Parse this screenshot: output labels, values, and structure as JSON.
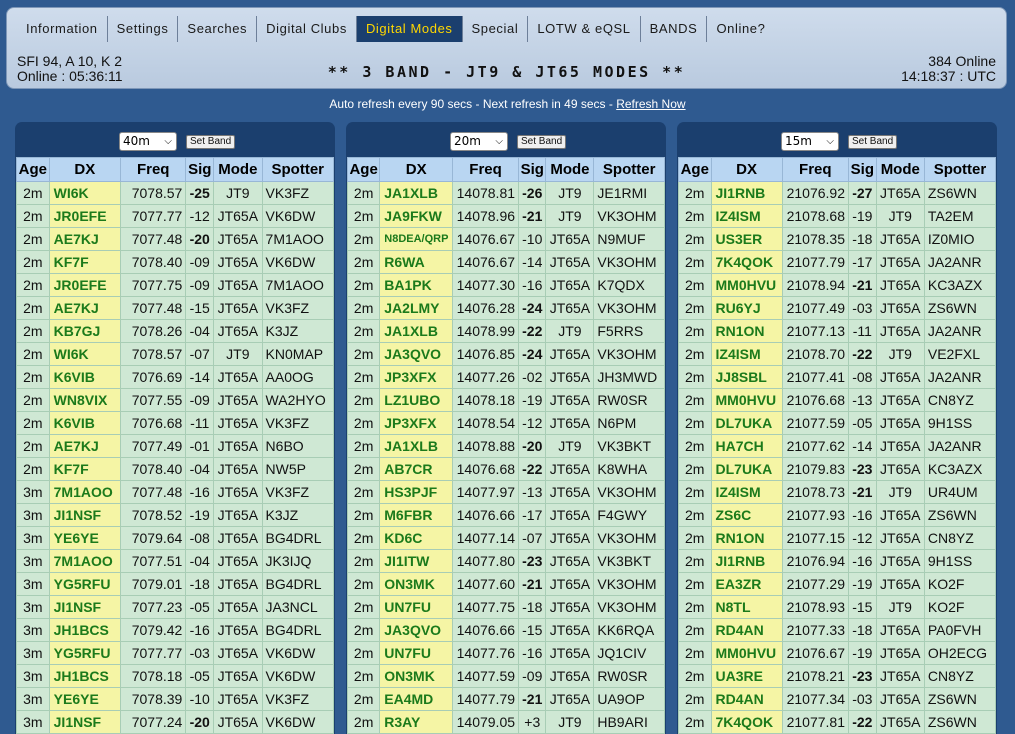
{
  "nav": [
    {
      "label": "Information",
      "active": false
    },
    {
      "label": "Settings",
      "active": false
    },
    {
      "label": "Searches",
      "active": false
    },
    {
      "label": "Digital Clubs",
      "active": false
    },
    {
      "label": "Digital Modes",
      "active": true
    },
    {
      "label": "Special",
      "active": false
    },
    {
      "label": "LOTW & eQSL",
      "active": false
    },
    {
      "label": "BANDS",
      "active": false
    },
    {
      "label": "Online?",
      "active": false
    }
  ],
  "status": {
    "solar": "SFI 94, A 10, K 2",
    "online_time": "Online : 05:36:11",
    "online_count": "384 Online",
    "utc_time": "14:18:37 : UTC"
  },
  "title": "** 3 BAND - JT9 & JT65 MODES **",
  "refresh": {
    "text": "Auto refresh every 90 secs - Next refresh in 49 secs - ",
    "link": "Refresh Now"
  },
  "set_band_label": "Set Band",
  "columns": [
    "Age",
    "DX",
    "Freq",
    "Sig",
    "Mode",
    "Spotter"
  ],
  "panels": [
    {
      "band": "40m",
      "rows": [
        [
          "2m",
          "WI6K",
          "7078.57",
          "-25",
          "JT9",
          "VK3FZ"
        ],
        [
          "2m",
          "JR0EFE",
          "7077.77",
          "-12",
          "JT65A",
          "VK6DW"
        ],
        [
          "2m",
          "AE7KJ",
          "7077.48",
          "-20",
          "JT65A",
          "7M1AOO"
        ],
        [
          "2m",
          "KF7F",
          "7078.40",
          "-09",
          "JT65A",
          "VK6DW"
        ],
        [
          "2m",
          "JR0EFE",
          "7077.75",
          "-09",
          "JT65A",
          "7M1AOO"
        ],
        [
          "2m",
          "AE7KJ",
          "7077.48",
          "-15",
          "JT65A",
          "VK3FZ"
        ],
        [
          "2m",
          "KB7GJ",
          "7078.26",
          "-04",
          "JT65A",
          "K3JZ"
        ],
        [
          "2m",
          "WI6K",
          "7078.57",
          "-07",
          "JT9",
          "KN0MAP"
        ],
        [
          "2m",
          "K6VIB",
          "7076.69",
          "-14",
          "JT65A",
          "AA0OG"
        ],
        [
          "2m",
          "WN8VIX",
          "7077.55",
          "-09",
          "JT65A",
          "WA2HYO"
        ],
        [
          "2m",
          "K6VIB",
          "7076.68",
          "-11",
          "JT65A",
          "VK3FZ"
        ],
        [
          "2m",
          "AE7KJ",
          "7077.49",
          "-01",
          "JT65A",
          "N6BO"
        ],
        [
          "2m",
          "KF7F",
          "7078.40",
          "-04",
          "JT65A",
          "NW5P"
        ],
        [
          "3m",
          "7M1AOO",
          "7077.48",
          "-16",
          "JT65A",
          "VK3FZ"
        ],
        [
          "3m",
          "JI1NSF",
          "7078.52",
          "-19",
          "JT65A",
          "K3JZ"
        ],
        [
          "3m",
          "YE6YE",
          "7079.64",
          "-08",
          "JT65A",
          "BG4DRL"
        ],
        [
          "3m",
          "7M1AOO",
          "7077.51",
          "-04",
          "JT65A",
          "JK3IJQ"
        ],
        [
          "3m",
          "YG5RFU",
          "7079.01",
          "-18",
          "JT65A",
          "BG4DRL"
        ],
        [
          "3m",
          "JI1NSF",
          "7077.23",
          "-05",
          "JT65A",
          "JA3NCL"
        ],
        [
          "3m",
          "JH1BCS",
          "7079.42",
          "-16",
          "JT65A",
          "BG4DRL"
        ],
        [
          "3m",
          "YG5RFU",
          "7077.77",
          "-03",
          "JT65A",
          "VK6DW"
        ],
        [
          "3m",
          "JH1BCS",
          "7078.18",
          "-05",
          "JT65A",
          "VK6DW"
        ],
        [
          "3m",
          "YE6YE",
          "7078.39",
          "-10",
          "JT65A",
          "VK3FZ"
        ],
        [
          "3m",
          "JI1NSF",
          "7077.24",
          "-20",
          "JT65A",
          "VK6DW"
        ]
      ]
    },
    {
      "band": "20m",
      "rows": [
        [
          "2m",
          "JA1XLB",
          "14078.81",
          "-26",
          "JT9",
          "JE1RMI"
        ],
        [
          "2m",
          "JA9FKW",
          "14078.96",
          "-21",
          "JT9",
          "VK3OHM"
        ],
        [
          "2m",
          "N8DEA/QRP",
          "14076.67",
          "-10",
          "JT65A",
          "N9MUF"
        ],
        [
          "2m",
          "R6WA",
          "14076.67",
          "-14",
          "JT65A",
          "VK3OHM"
        ],
        [
          "2m",
          "BA1PK",
          "14077.30",
          "-16",
          "JT65A",
          "K7QDX"
        ],
        [
          "2m",
          "JA2LMY",
          "14076.28",
          "-24",
          "JT65A",
          "VK3OHM"
        ],
        [
          "2m",
          "JA1XLB",
          "14078.99",
          "-22",
          "JT9",
          "F5RRS"
        ],
        [
          "2m",
          "JA3QVO",
          "14076.85",
          "-24",
          "JT65A",
          "VK3OHM"
        ],
        [
          "2m",
          "JP3XFX",
          "14077.26",
          "-02",
          "JT65A",
          "JH3MWD"
        ],
        [
          "2m",
          "LZ1UBO",
          "14078.18",
          "-19",
          "JT65A",
          "RW0SR"
        ],
        [
          "2m",
          "JP3XFX",
          "14078.54",
          "-12",
          "JT65A",
          "N6PM"
        ],
        [
          "2m",
          "JA1XLB",
          "14078.88",
          "-20",
          "JT9",
          "VK3BKT"
        ],
        [
          "2m",
          "AB7CR",
          "14076.68",
          "-22",
          "JT65A",
          "K8WHA"
        ],
        [
          "2m",
          "HS3PJF",
          "14077.97",
          "-13",
          "JT65A",
          "VK3OHM"
        ],
        [
          "2m",
          "M6FBR",
          "14076.66",
          "-17",
          "JT65A",
          "F4GWY"
        ],
        [
          "2m",
          "KD6C",
          "14077.14",
          "-07",
          "JT65A",
          "VK3OHM"
        ],
        [
          "2m",
          "JI1ITW",
          "14077.80",
          "-23",
          "JT65A",
          "VK3BKT"
        ],
        [
          "2m",
          "ON3MK",
          "14077.60",
          "-21",
          "JT65A",
          "VK3OHM"
        ],
        [
          "2m",
          "UN7FU",
          "14077.75",
          "-18",
          "JT65A",
          "VK3OHM"
        ],
        [
          "2m",
          "JA3QVO",
          "14076.66",
          "-15",
          "JT65A",
          "KK6RQA"
        ],
        [
          "2m",
          "UN7FU",
          "14077.76",
          "-16",
          "JT65A",
          "JQ1CIV"
        ],
        [
          "2m",
          "ON3MK",
          "14077.59",
          "-09",
          "JT65A",
          "RW0SR"
        ],
        [
          "2m",
          "EA4MD",
          "14077.79",
          "-21",
          "JT65A",
          "UA9OP"
        ],
        [
          "2m",
          "R3AY",
          "14079.05",
          "+3",
          "JT9",
          "HB9ARI"
        ]
      ]
    },
    {
      "band": "15m",
      "rows": [
        [
          "2m",
          "JI1RNB",
          "21076.92",
          "-27",
          "JT65A",
          "ZS6WN"
        ],
        [
          "2m",
          "IZ4ISM",
          "21078.68",
          "-19",
          "JT9",
          "TA2EM"
        ],
        [
          "2m",
          "US3ER",
          "21078.35",
          "-18",
          "JT65A",
          "IZ0MIO"
        ],
        [
          "2m",
          "7K4QOK",
          "21077.79",
          "-17",
          "JT65A",
          "JA2ANR"
        ],
        [
          "2m",
          "MM0HVU",
          "21078.94",
          "-21",
          "JT65A",
          "KC3AZX"
        ],
        [
          "2m",
          "RU6YJ",
          "21077.49",
          "-03",
          "JT65A",
          "ZS6WN"
        ],
        [
          "2m",
          "RN1ON",
          "21077.13",
          "-11",
          "JT65A",
          "JA2ANR"
        ],
        [
          "2m",
          "IZ4ISM",
          "21078.70",
          "-22",
          "JT9",
          "VE2FXL"
        ],
        [
          "2m",
          "JJ8SBL",
          "21077.41",
          "-08",
          "JT65A",
          "JA2ANR"
        ],
        [
          "2m",
          "MM0HVU",
          "21076.68",
          "-13",
          "JT65A",
          "CN8YZ"
        ],
        [
          "2m",
          "DL7UKA",
          "21077.59",
          "-05",
          "JT65A",
          "9H1SS"
        ],
        [
          "2m",
          "HA7CH",
          "21077.62",
          "-14",
          "JT65A",
          "JA2ANR"
        ],
        [
          "2m",
          "DL7UKA",
          "21079.83",
          "-23",
          "JT65A",
          "KC3AZX"
        ],
        [
          "2m",
          "IZ4ISM",
          "21078.73",
          "-21",
          "JT9",
          "UR4UM"
        ],
        [
          "2m",
          "ZS6C",
          "21077.93",
          "-16",
          "JT65A",
          "ZS6WN"
        ],
        [
          "2m",
          "RN1ON",
          "21077.15",
          "-12",
          "JT65A",
          "CN8YZ"
        ],
        [
          "2m",
          "JI1RNB",
          "21076.94",
          "-16",
          "JT65A",
          "9H1SS"
        ],
        [
          "2m",
          "EA3ZR",
          "21077.29",
          "-19",
          "JT65A",
          "KO2F"
        ],
        [
          "2m",
          "N8TL",
          "21078.93",
          "-15",
          "JT9",
          "KO2F"
        ],
        [
          "2m",
          "RD4AN",
          "21077.33",
          "-18",
          "JT65A",
          "PA0FVH"
        ],
        [
          "2m",
          "MM0HVU",
          "21076.67",
          "-19",
          "JT65A",
          "OH2ECG"
        ],
        [
          "2m",
          "UA3RE",
          "21078.21",
          "-23",
          "JT65A",
          "CN8YZ"
        ],
        [
          "2m",
          "RD4AN",
          "21077.34",
          "-03",
          "JT65A",
          "ZS6WN"
        ],
        [
          "2m",
          "7K4QOK",
          "21077.81",
          "-22",
          "JT65A",
          "ZS6WN"
        ]
      ]
    }
  ]
}
